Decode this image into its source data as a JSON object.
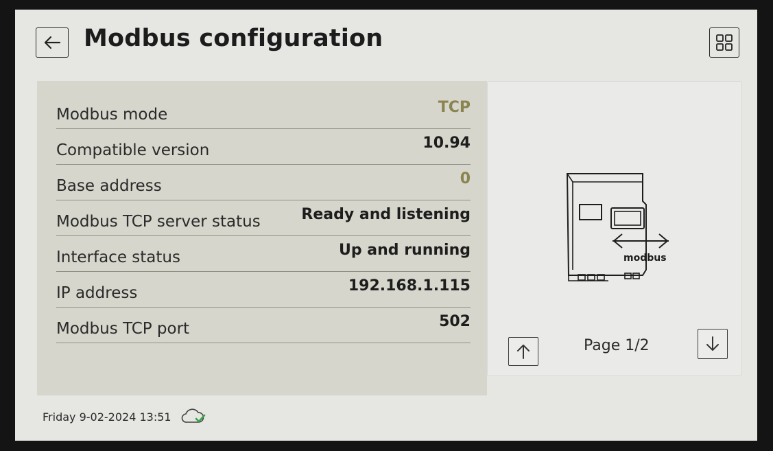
{
  "header": {
    "title": "Modbus configuration",
    "back_icon": "arrow-left-icon",
    "menu_icon": "grid-icon"
  },
  "settings": [
    {
      "label": "Modbus mode",
      "value": "TCP",
      "accent": true
    },
    {
      "label": "Compatible version",
      "value": "10.94",
      "accent": false
    },
    {
      "label": "Base address",
      "value": "0",
      "accent": true
    },
    {
      "label": "Modbus TCP server status",
      "value": "Ready and listening",
      "accent": false
    },
    {
      "label": "Interface status",
      "value": "Up and running",
      "accent": false
    },
    {
      "label": "IP address",
      "value": "192.168.1.115",
      "accent": false
    },
    {
      "label": "Modbus TCP port",
      "value": "502",
      "accent": false
    }
  ],
  "illustration": {
    "caption": "modbus",
    "icon": "modbus-device-icon"
  },
  "pagination": {
    "label": "Page 1/2",
    "up_icon": "arrow-up-icon",
    "down_icon": "arrow-down-icon"
  },
  "footer": {
    "datetime": "Friday 9-02-2024 13:51",
    "cloud_icon": "cloud-check-icon"
  },
  "colors": {
    "accent": "#8a8450",
    "panel": "#d6d6cc",
    "screen": "#e6e6e3"
  }
}
